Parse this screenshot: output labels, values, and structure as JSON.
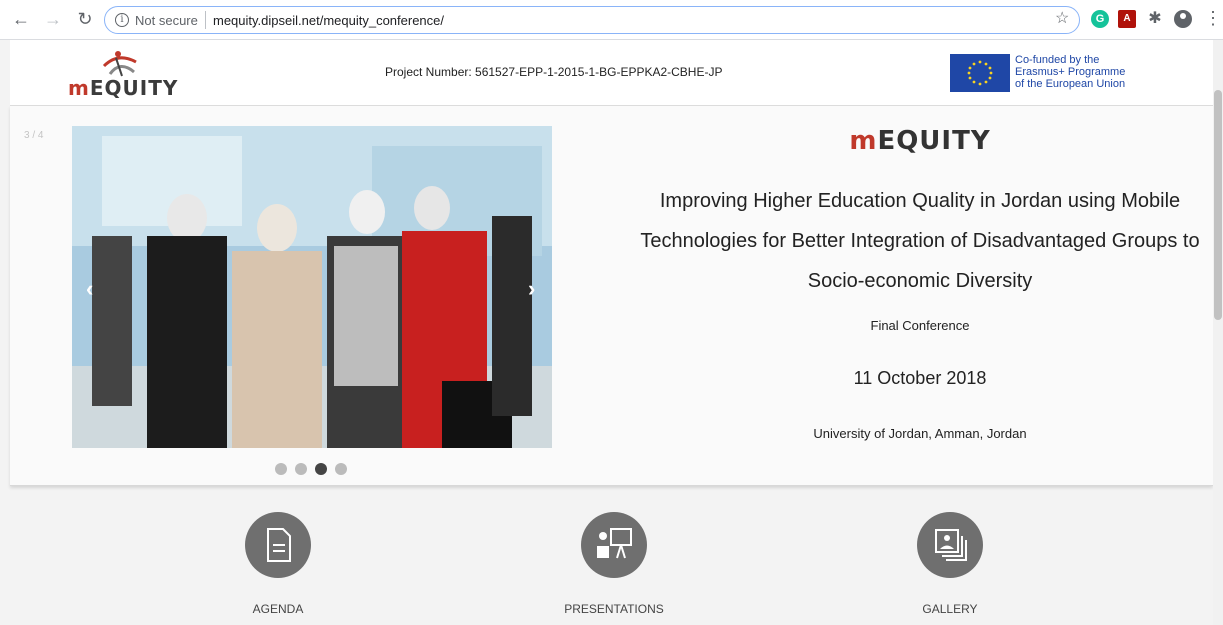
{
  "browser": {
    "security_label": "Not secure",
    "url": "mequity.dipseil.net/mequity_conference/"
  },
  "header": {
    "logo_text_m": "m",
    "logo_text_rest": "EQUITY",
    "project_number": "Project Number: 561527-EPP-1-2015-1-BG-EPPKA2-CBHE-JP",
    "eu_line1": "Co-funded by the",
    "eu_line2": "Erasmus+ Programme",
    "eu_line3": "of the European Union"
  },
  "hero": {
    "slide_counter": "3 / 4",
    "brand_m": "m",
    "brand_rest": "EQUITY",
    "title_line1": "Improving Higher Education Quality in Jordan using Mobile",
    "title_line2": "Technologies for Better Integration of Disadvantaged Groups to",
    "title_line3": "Socio-economic Diversity",
    "subtitle": "Final Conference",
    "date": "11 October 2018",
    "venue": "University of Jordan, Amman, Jordan",
    "dots_total": 4,
    "active_dot": 3
  },
  "tiles": [
    {
      "label": "AGENDA",
      "icon": "document-icon"
    },
    {
      "label": "PRESENTATIONS",
      "icon": "presenter-icon"
    },
    {
      "label": "GALLERY",
      "icon": "photo-gallery-icon"
    }
  ],
  "colors": {
    "brand_red": "#c0392b",
    "eu_blue": "#1f47a6",
    "tile_grey": "#6f6f6f"
  }
}
